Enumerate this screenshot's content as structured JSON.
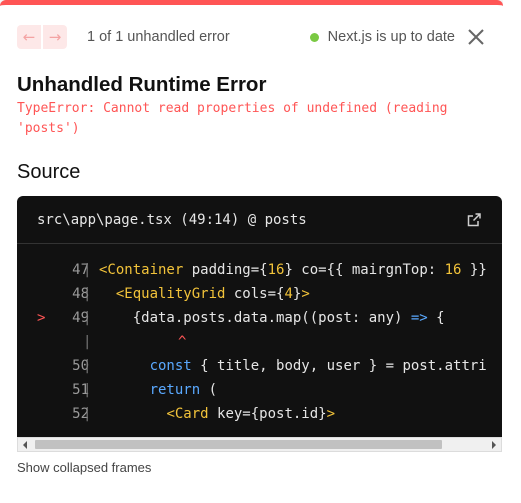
{
  "overlay": {
    "accent_color": "#ff5555",
    "nav": {
      "prev_icon": "arrow-left-icon",
      "next_icon": "arrow-right-icon",
      "prev_label": "←",
      "next_label": "→"
    },
    "counter_text": "1 of 1 unhandled error",
    "status": {
      "text": "Next.js is up to date",
      "dot_color": "#7ac943"
    },
    "close_icon": "close-icon"
  },
  "error": {
    "title": "Unhandled Runtime Error",
    "message": "TypeError: Cannot read properties of undefined (reading 'posts')"
  },
  "source": {
    "heading": "Source",
    "file_ref": "src\\app\\page.tsx (49:14) @ posts",
    "open_in_editor_icon": "external-link-icon",
    "caret": "^",
    "error_marker": ">",
    "lines": [
      {
        "num": "47",
        "text": "<Container padding={16} co={{ mairgnTop: 16 }}"
      },
      {
        "num": "48",
        "text": "  <EqualityGrid cols={4}>"
      },
      {
        "num": "49",
        "text": "    {data.posts.data.map((post: any) => {"
      },
      {
        "num": "50",
        "text": "      const { title, body, user } = post.attri"
      },
      {
        "num": "51",
        "text": "      return ("
      },
      {
        "num": "52",
        "text": "        <Card key={post.id}>"
      }
    ]
  },
  "footer": {
    "collapsed_frames_label": "Show collapsed frames"
  }
}
